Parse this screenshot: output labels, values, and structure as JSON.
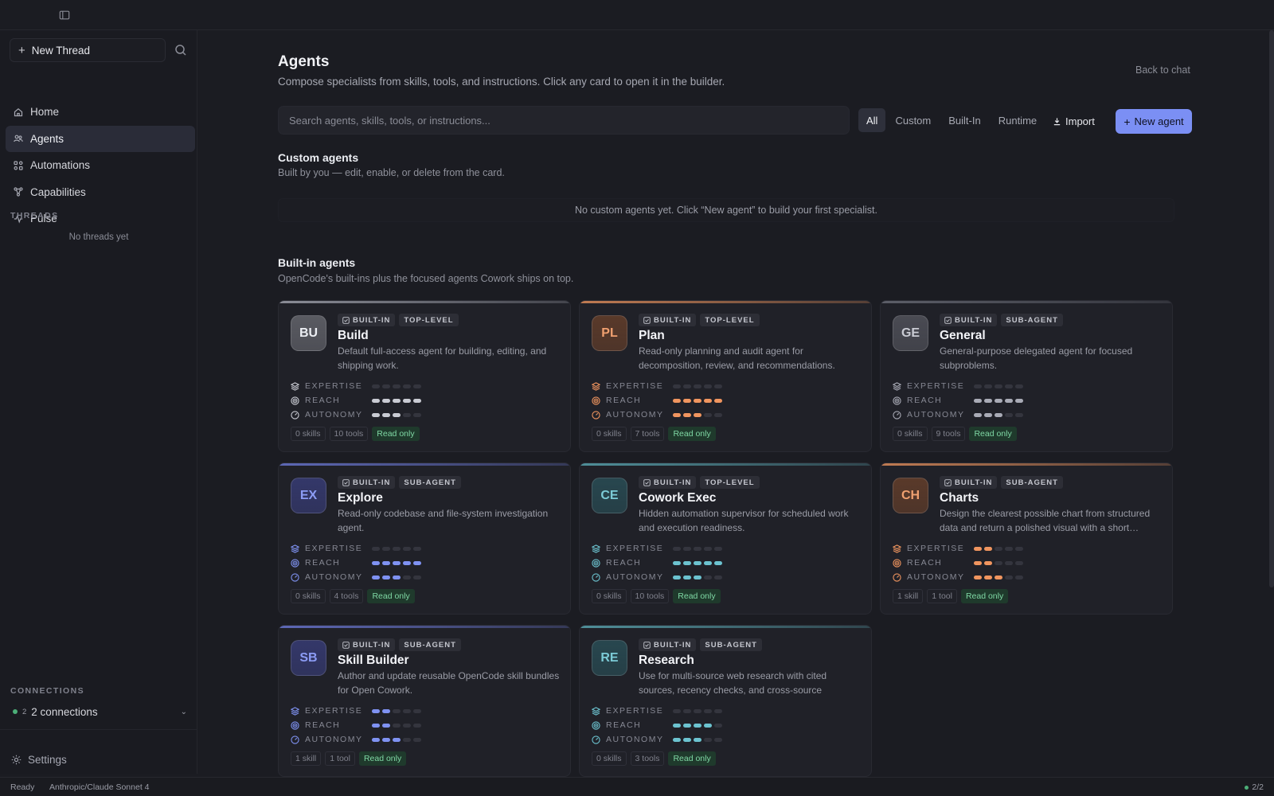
{
  "sidebar": {
    "new_thread": "New Thread",
    "nav": [
      {
        "label": "Home",
        "icon": "home-icon"
      },
      {
        "label": "Agents",
        "icon": "users-icon",
        "active": true
      },
      {
        "label": "Automations",
        "icon": "automation-icon"
      },
      {
        "label": "Capabilities",
        "icon": "capabilities-icon"
      },
      {
        "label": "Pulse",
        "icon": "pulse-icon"
      }
    ],
    "threads_label": "THREADS",
    "no_threads": "No threads yet",
    "connections_label": "CONNECTIONS",
    "connections_count": "2",
    "connections_text": "2 connections",
    "settings": "Settings"
  },
  "header": {
    "title": "Agents",
    "subtitle": "Compose specialists from skills, tools, and instructions. Click any card to open it in the builder.",
    "back": "Back to chat"
  },
  "search": {
    "placeholder": "Search agents, skills, tools, or instructions..."
  },
  "filters": [
    "All",
    "Custom",
    "Built-In",
    "Runtime"
  ],
  "actions": {
    "import": "Import",
    "new_agent": "New agent"
  },
  "custom": {
    "title": "Custom agents",
    "subtitle": "Built by you — edit, enable, or delete from the card.",
    "empty": "No custom agents yet. Click “New agent” to build your first specialist."
  },
  "builtin": {
    "title": "Built-in agents",
    "subtitle": "OpenCode's built-ins plus the focused agents Cowork ships on top."
  },
  "metric_labels": {
    "expertise": "EXPERTISE",
    "reach": "REACH",
    "autonomy": "AUTONOMY"
  },
  "badge_builtin": "BUILT-IN",
  "agents": [
    {
      "initials": "BU",
      "name": "Build",
      "kind": "TOP-LEVEL",
      "desc": "Default full-access agent for building, editing, and shipping work.",
      "expertise": 0,
      "reach": 5,
      "autonomy": 3,
      "skills": "0 skills",
      "tools": "10 tools",
      "access": "Read only",
      "color": "#c9cbd3",
      "avatar_bg": "#5a5b62",
      "avatar_fg": "#eceef3",
      "accent": "#8a8c96"
    },
    {
      "initials": "PL",
      "name": "Plan",
      "kind": "TOP-LEVEL",
      "desc": "Read-only planning and audit agent for decomposition, review, and recommendations.",
      "expertise": 0,
      "reach": 5,
      "autonomy": 3,
      "skills": "0 skills",
      "tools": "7 tools",
      "access": "Read only",
      "color": "#f0955f",
      "avatar_bg": "#5a3a2a",
      "avatar_fg": "#f0a070",
      "accent": "#c07b52"
    },
    {
      "initials": "GE",
      "name": "General",
      "kind": "SUB-AGENT",
      "desc": "General-purpose delegated agent for focused subproblems.",
      "expertise": 0,
      "reach": 5,
      "autonomy": 3,
      "skills": "0 skills",
      "tools": "9 tools",
      "access": "Read only",
      "color": "#a9abb6",
      "avatar_bg": "#4a4b53",
      "avatar_fg": "#c9cbd3",
      "accent": "#5c5e68"
    },
    {
      "initials": "EX",
      "name": "Explore",
      "kind": "SUB-AGENT",
      "desc": "Read-only codebase and file-system investigation agent.",
      "expertise": 0,
      "reach": 5,
      "autonomy": 3,
      "skills": "0 skills",
      "tools": "4 tools",
      "access": "Read only",
      "color": "#7f92f2",
      "avatar_bg": "#34386a",
      "avatar_fg": "#8c9cf5",
      "accent": "#5d68b6"
    },
    {
      "initials": "CE",
      "name": "Cowork Exec",
      "kind": "TOP-LEVEL",
      "desc": "Hidden automation supervisor for scheduled work and execution readiness.",
      "expertise": 0,
      "reach": 5,
      "autonomy": 3,
      "skills": "0 skills",
      "tools": "10 tools",
      "access": "Read only",
      "color": "#6cc3d0",
      "avatar_bg": "#28474f",
      "avatar_fg": "#7ccbd6",
      "accent": "#4f8f99"
    },
    {
      "initials": "CH",
      "name": "Charts",
      "kind": "SUB-AGENT",
      "desc": "Design the clearest possible chart from structured data and return a polished visual with a short…",
      "expertise": 2,
      "reach": 2,
      "autonomy": 3,
      "skills": "1 skill",
      "tools": "1 tool",
      "access": "Read only",
      "color": "#f0955f",
      "avatar_bg": "#5a3a2a",
      "avatar_fg": "#f0a070",
      "accent": "#c07b52"
    },
    {
      "initials": "SB",
      "name": "Skill Builder",
      "kind": "SUB-AGENT",
      "desc": "Author and update reusable OpenCode skill bundles for Open Cowork.",
      "expertise": 2,
      "reach": 2,
      "autonomy": 3,
      "skills": "1 skill",
      "tools": "1 tool",
      "access": "Read only",
      "color": "#7f92f2",
      "avatar_bg": "#34386a",
      "avatar_fg": "#8c9cf5",
      "accent": "#5d68b6"
    },
    {
      "initials": "RE",
      "name": "Research",
      "kind": "SUB-AGENT",
      "desc": "Use for multi-source web research with cited sources, recency checks, and cross-source synthesis. Prefer…",
      "expertise": 0,
      "reach": 4,
      "autonomy": 3,
      "skills": "0 skills",
      "tools": "3 tools",
      "access": "Read only",
      "color": "#6cc3d0",
      "avatar_bg": "#28474f",
      "avatar_fg": "#7ccbd6",
      "accent": "#4f8f99"
    }
  ],
  "status": {
    "ready": "Ready",
    "model": "Anthropic/Claude Sonnet 4",
    "count": "2/2"
  }
}
